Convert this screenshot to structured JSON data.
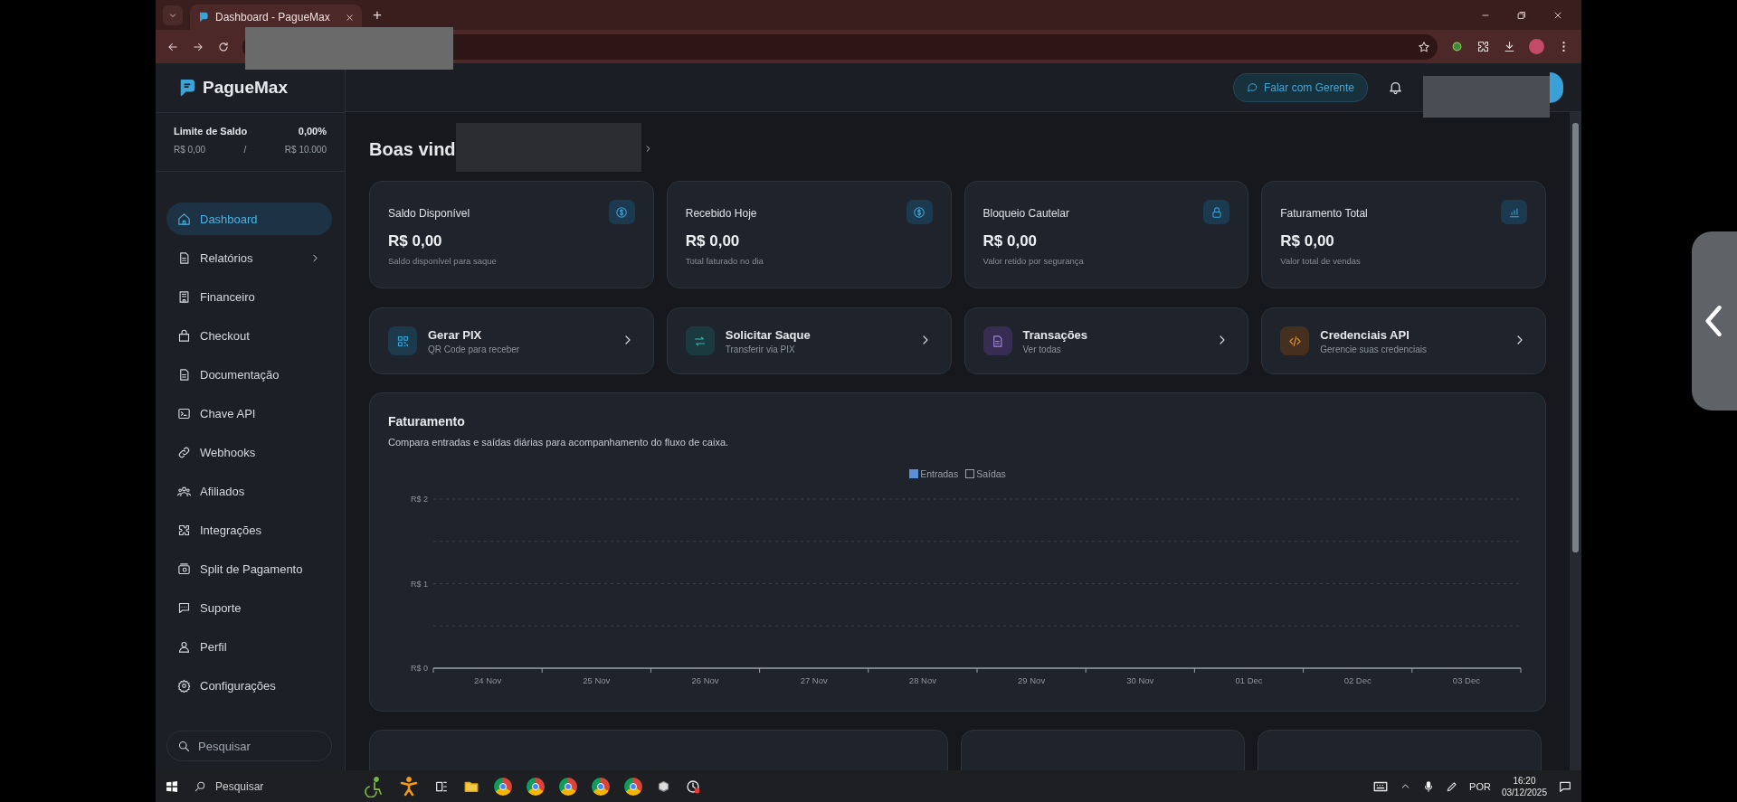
{
  "browser": {
    "tab_title": "Dashboard - PagueMax",
    "new_tab": "+"
  },
  "app": {
    "logo": "PagueMax",
    "header_button": "Falar com Gerente"
  },
  "sidebar": {
    "limit": {
      "label": "Limite de Saldo",
      "percent": "0,00%",
      "current": "R$ 0,00",
      "separator": "/",
      "max": "R$ 10.000"
    },
    "items": [
      {
        "label": "Dashboard",
        "selected": true,
        "submenu": false
      },
      {
        "label": "Relatórios",
        "selected": false,
        "submenu": true
      },
      {
        "label": "Financeiro",
        "selected": false,
        "submenu": false
      },
      {
        "label": "Checkout",
        "selected": false,
        "submenu": false
      },
      {
        "label": "Documentação",
        "selected": false,
        "submenu": false
      },
      {
        "label": "Chave API",
        "selected": false,
        "submenu": false
      },
      {
        "label": "Webhooks",
        "selected": false,
        "submenu": false
      },
      {
        "label": "Afiliados",
        "selected": false,
        "submenu": false
      },
      {
        "label": "Integrações",
        "selected": false,
        "submenu": false
      },
      {
        "label": "Split de Pagamento",
        "selected": false,
        "submenu": false
      },
      {
        "label": "Suporte",
        "selected": false,
        "submenu": false
      },
      {
        "label": "Perfil",
        "selected": false,
        "submenu": false
      },
      {
        "label": "Configurações",
        "selected": false,
        "submenu": false
      }
    ],
    "search": {
      "placeholder": "Pesquisar"
    }
  },
  "greeting": "Boas vind",
  "stats": [
    {
      "label": "Saldo Disponível",
      "value": "R$ 0,00",
      "caption": "Saldo disponível para saque"
    },
    {
      "label": "Recebido Hoje",
      "value": "R$ 0,00",
      "caption": "Total faturado no dia"
    },
    {
      "label": "Bloqueio Cautelar",
      "value": "R$ 0,00",
      "caption": "Valor retido por segurança"
    },
    {
      "label": "Faturamento Total",
      "value": "R$ 0,00",
      "caption": "Valor total de vendas"
    }
  ],
  "actions": [
    {
      "title": "Gerar PIX",
      "subtitle": "QR Code para receber",
      "color": "#1d3a4d"
    },
    {
      "title": "Solicitar Saque",
      "subtitle": "Transferir via PIX",
      "color": "#1b3a40"
    },
    {
      "title": "Transações",
      "subtitle": "Ver todas",
      "color": "#372c52"
    },
    {
      "title": "Credenciais API",
      "subtitle": "Gerencie suas credenciais",
      "color": "#45301f"
    }
  ],
  "revenue": {
    "title": "Faturamento",
    "description": "Compara entradas e saídas diárias para acompanhamento do fluxo de caixa.",
    "legend": [
      {
        "name": "Entradas",
        "color": "#5b8fd6",
        "selected": true
      },
      {
        "name": "Saídas",
        "color": "#9ca3af",
        "selected": false
      }
    ],
    "y_labels": [
      "R$ 2",
      "R$ 1",
      "R$ 0"
    ],
    "x_labels": [
      "24 Nov",
      "25 Nov",
      "26 Nov",
      "27 Nov",
      "28 Nov",
      "29 Nov",
      "30 Nov",
      "01 Dec",
      "02 Dec",
      "03 Dec"
    ]
  },
  "taskbar": {
    "search_placeholder": "Pesquisar",
    "language": "POR",
    "time": "16:20",
    "date": "03/12/2025"
  }
}
